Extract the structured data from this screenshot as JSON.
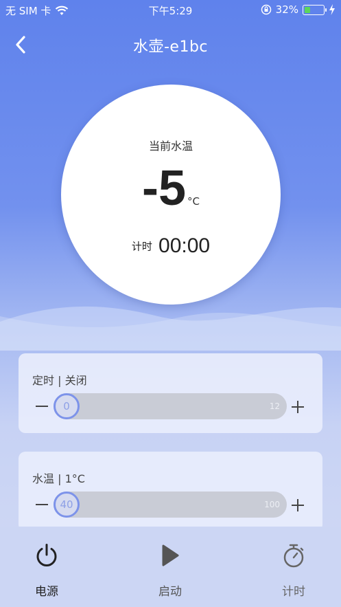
{
  "status_bar": {
    "carrier": "无 SIM 卡",
    "time": "下午5:29",
    "battery_percent": "32%",
    "battery_level": 0.32,
    "battery_color": "#5cd65c",
    "icons": [
      "wifi-icon",
      "orientation-lock-icon",
      "battery-icon",
      "charging-icon"
    ]
  },
  "header": {
    "title": "水壶-e1bc",
    "back_icon": "chevron-left-icon"
  },
  "dial": {
    "label": "当前水温",
    "temperature": "-5",
    "unit": "°C",
    "timer_label": "计时",
    "timer_value": "00:00"
  },
  "controls": [
    {
      "label": "定时 | 关闭",
      "value": "0",
      "max_label": "12",
      "level": 0
    },
    {
      "label": "水温 | 1°C",
      "value": "40",
      "max_label": "100",
      "level": 0
    }
  ],
  "tabs": [
    {
      "label": "电源",
      "icon": "power-icon",
      "color": "#222222"
    },
    {
      "label": "启动",
      "icon": "play-icon",
      "color": "#555555"
    },
    {
      "label": "计时",
      "icon": "stopwatch-icon",
      "color": "#666666"
    }
  ],
  "colors": {
    "accent": "#7d93ea",
    "header_blue": "#5f82ec"
  }
}
